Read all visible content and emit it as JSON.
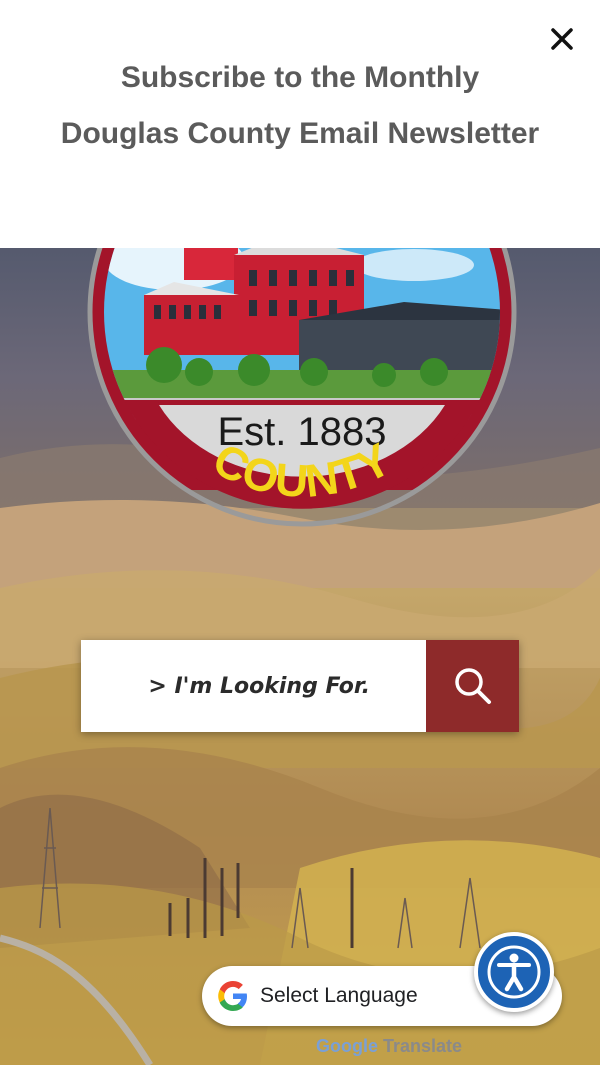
{
  "banner": {
    "title": "Subscribe to the Monthly Douglas County Email Newsletter",
    "close_icon": "close-icon"
  },
  "seal": {
    "established": "Est. 1883",
    "county": "COUNTY",
    "colors": {
      "ring": "#a3142a",
      "gold": "#f3d51a",
      "sky": "#58b6ea"
    }
  },
  "search": {
    "placeholder": "> I'm Looking For.",
    "icon": "search-icon",
    "button_color": "#8e2a2a"
  },
  "translate": {
    "label": "Select Language",
    "powered_google": "Google",
    "powered_translate": "Translate"
  },
  "accessibility": {
    "icon": "accessibility-icon",
    "color": "#1d63b5"
  }
}
